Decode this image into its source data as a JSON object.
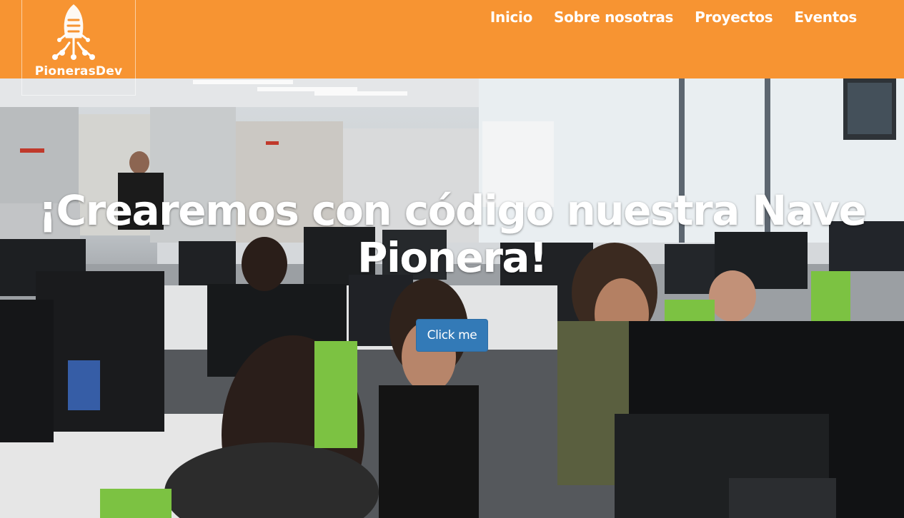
{
  "brand": {
    "name": "PionerasDev",
    "logo_icon": "rocket-circuit-icon"
  },
  "nav": {
    "items": [
      "Inicio",
      "Sobre nosotras",
      "Proyectos",
      "Eventos"
    ]
  },
  "hero": {
    "title": "¡Crearemos con código nuestra Nave Pionera!",
    "button_label": "Click me"
  },
  "colors": {
    "navbar": "#f79432",
    "button": "#337ab7",
    "text": "#ffffff"
  }
}
